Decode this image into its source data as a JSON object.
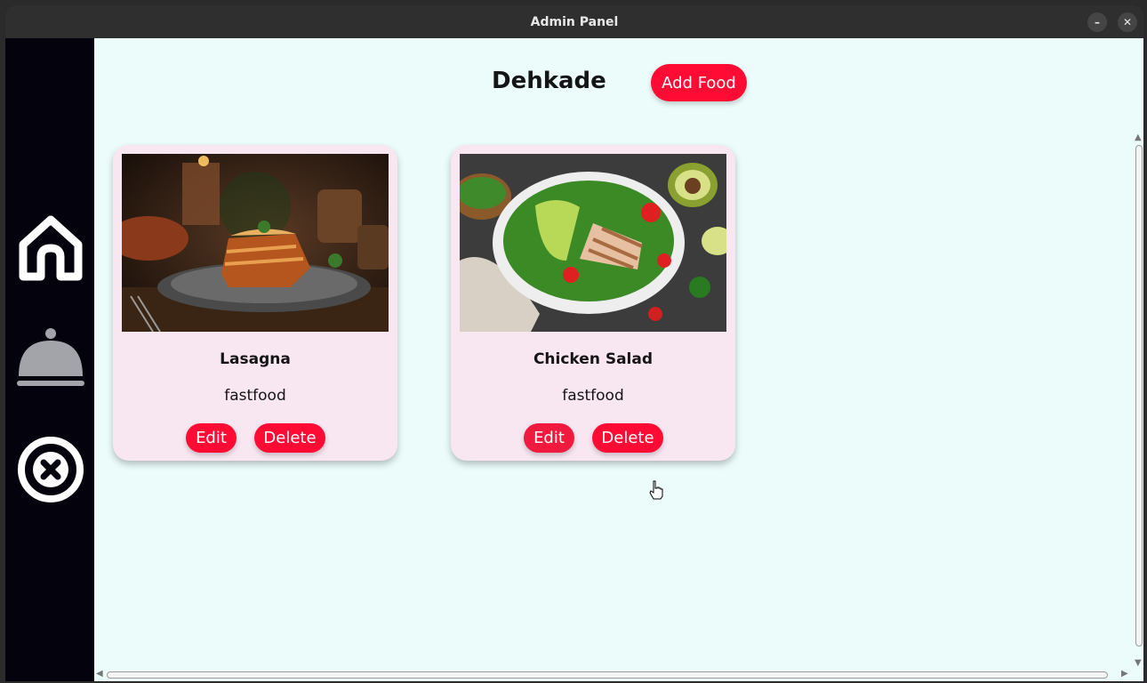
{
  "window": {
    "title": "Admin Panel",
    "minimize_label": "–",
    "close_label": "✕"
  },
  "sidebar": {
    "items": [
      {
        "icon": "home-icon"
      },
      {
        "icon": "cloche-icon"
      },
      {
        "icon": "exit-icon"
      }
    ]
  },
  "header": {
    "title": "Dehkade",
    "add_button": "Add Food"
  },
  "foods": [
    {
      "name": "Lasagna",
      "category": "fastfood",
      "edit_label": "Edit",
      "delete_label": "Delete",
      "image": "lasagna-photo"
    },
    {
      "name": "Chicken Salad",
      "category": "fastfood",
      "edit_label": "Edit",
      "delete_label": "Delete",
      "image": "chicken-salad-photo"
    }
  ],
  "colors": {
    "accent": "#ff0b34",
    "content_bg": "#ecfcfb",
    "card_bg": "#f8e6f1",
    "sidebar_bg": "#04020c"
  }
}
